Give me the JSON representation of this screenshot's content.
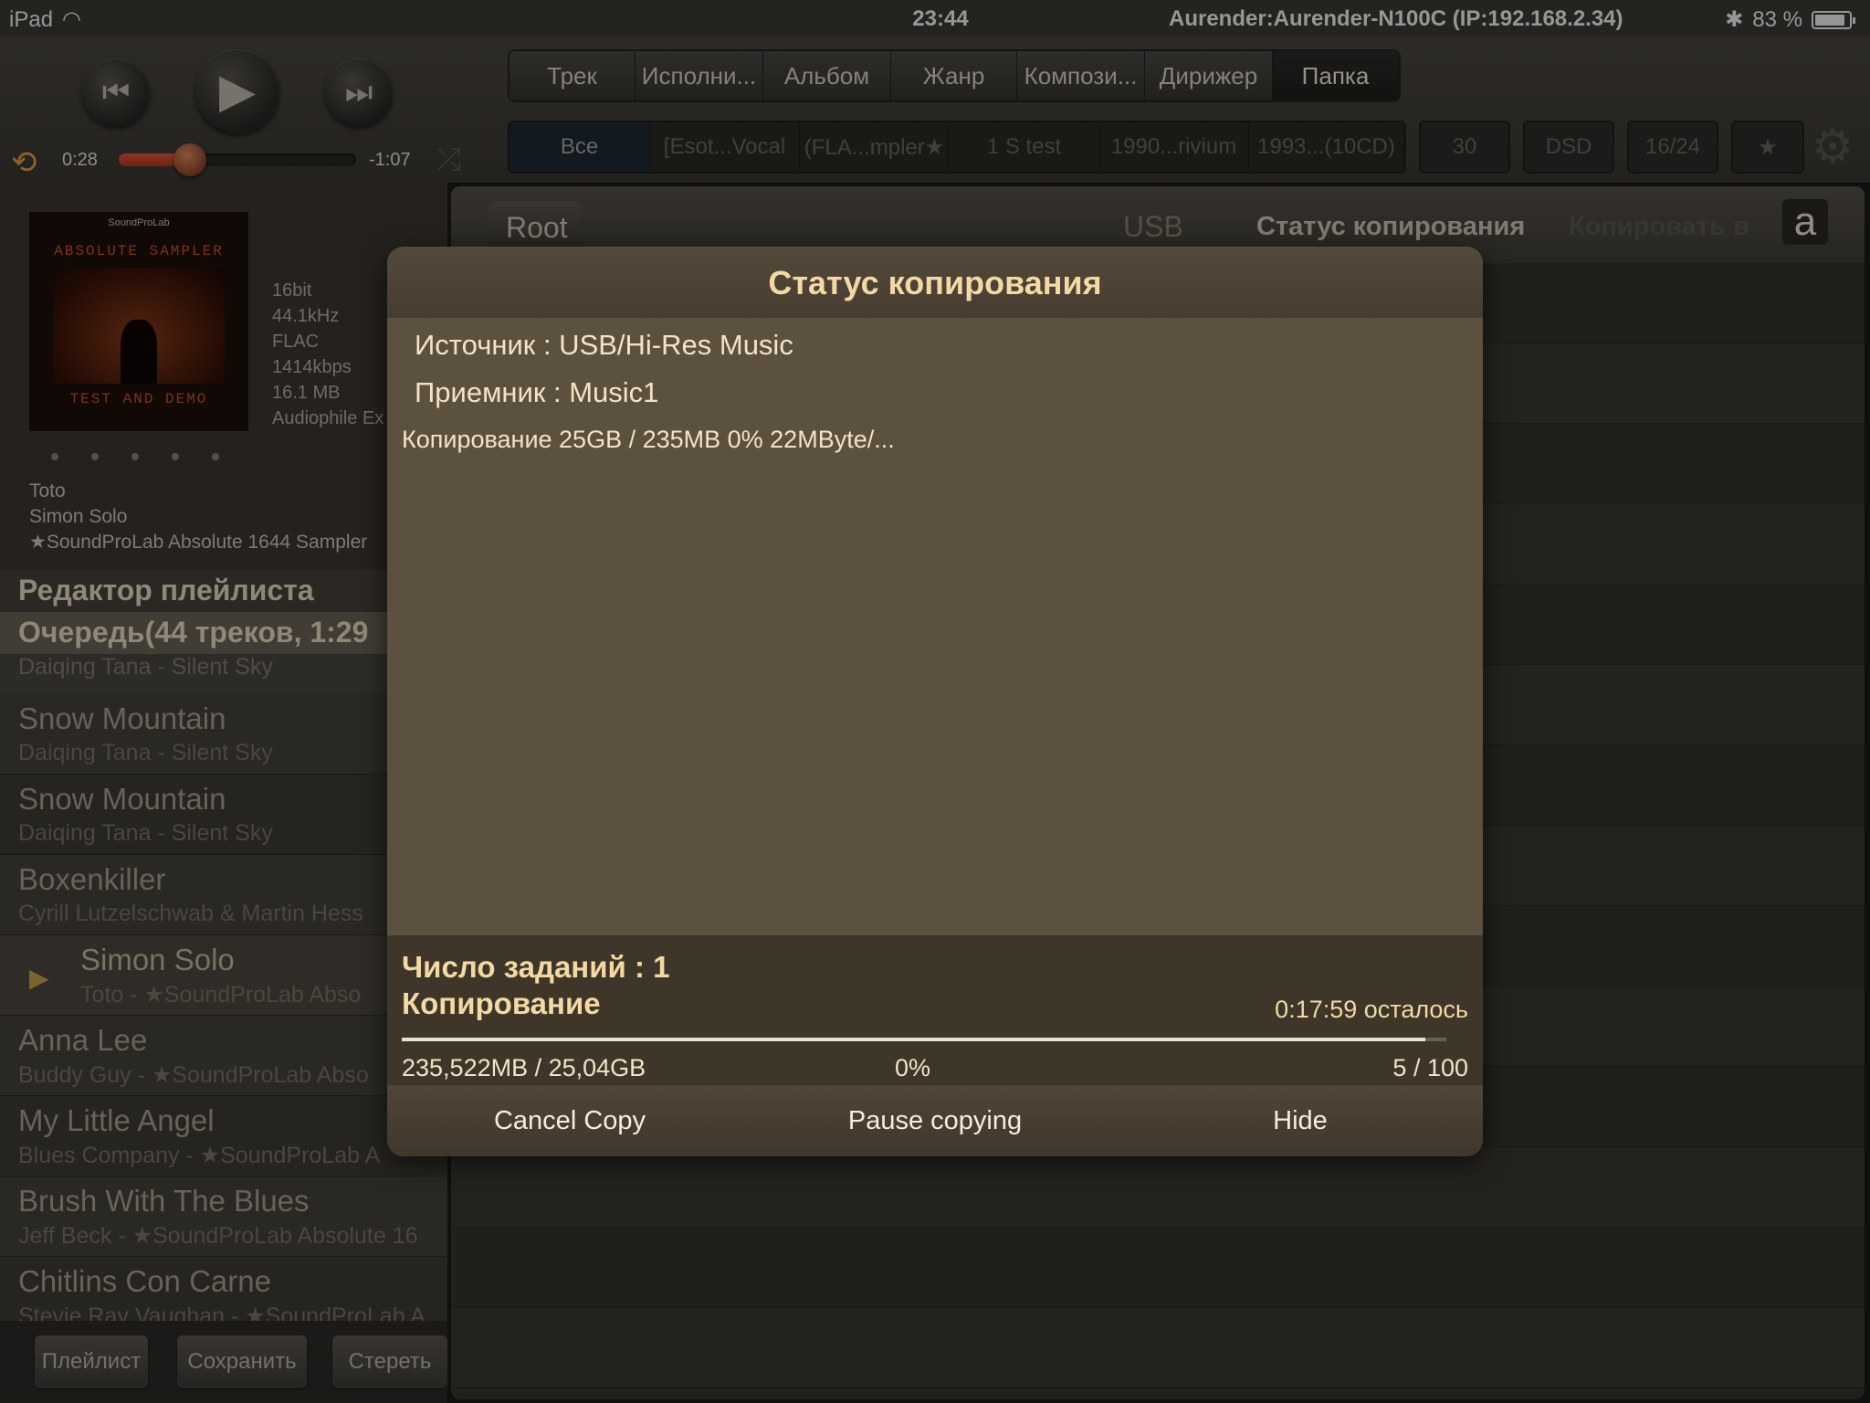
{
  "status_bar": {
    "device": "iPad",
    "time": "23:44",
    "connection": "Aurender:Aurender-N100C (IP:192.168.2.34)",
    "battery": "83 %"
  },
  "player": {
    "elapsed": "0:28",
    "remaining": "-1:07",
    "progress": 0.3
  },
  "tabs": [
    "Трек",
    "Исполни...",
    "Альбом",
    "Жанр",
    "Компози...",
    "Дирижер",
    "Папка"
  ],
  "active_tab": "Папка",
  "filters": [
    "Все",
    "[Esot...Vocal",
    "(FLA...mpler★",
    "1 S test",
    "1990...rivium",
    "1993...(10CD)"
  ],
  "chips": [
    "30",
    "DSD",
    "16/24",
    "★"
  ],
  "now_playing": {
    "album_art": {
      "logo": "SoundProLab",
      "title": "ABSOLUTE SAMPLER",
      "bottom": "TEST AND DEMO"
    },
    "meta": [
      "16bit",
      "44.1kHz",
      "FLAC",
      "1414kbps",
      "16.1 MB",
      "Audiophile Ex"
    ],
    "artist": "Toto",
    "title": "Simon Solo",
    "album": "★SoundProLab Absolute 1644 Sampler"
  },
  "playlist_editor": "Редактор плейлиста",
  "queue_header": "Очередь(44 треков, 1:29",
  "queue_first_subtitle": "Daiqing Tana - Silent Sky",
  "queue": [
    {
      "title": "Snow Mountain",
      "subtitle": "Daiqing Tana - Silent Sky"
    },
    {
      "title": "Snow Mountain",
      "subtitle": "Daiqing Tana - Silent Sky"
    },
    {
      "title": "Boxenkiller",
      "subtitle": "Cyrill Lutzelschwab & Martin Hess"
    },
    {
      "title": "Simon Solo",
      "subtitle": "Toto - ★SoundProLab Abso"
    },
    {
      "title": "Anna Lee",
      "subtitle": "Buddy Guy - ★SoundProLab Abso"
    },
    {
      "title": "My Little Angel",
      "subtitle": "Blues Company - ★SoundProLab A"
    },
    {
      "title": "Brush With The Blues",
      "subtitle": "Jeff Beck - ★SoundProLab Absolute 16"
    },
    {
      "title": "Chitlins Con Carne",
      "subtitle": "Stevie Ray Vaughan - ★SoundProLab A"
    }
  ],
  "bottom_buttons": [
    "Плейлист",
    "Сохранить",
    "Стереть"
  ],
  "browser_nav": {
    "root": "Root",
    "usb": "USB",
    "status": "Статус копирования",
    "copy_to": "Копировать в",
    "a_icon": "a"
  },
  "dialog": {
    "title": "Статус копирования",
    "source": "Источник : USB/Hi-Res Music",
    "destination": "Приемник : Music1",
    "progress_line": "Копирование 25GB / 235MB 0% 22MByte/...",
    "jobs": "Число заданий : 1",
    "state": "Копирование",
    "remaining": "0:17:59 осталось",
    "progress": 0.98,
    "size": "235,522MB / 25,04GB",
    "percent": "0%",
    "files": "5 / 100",
    "actions": [
      "Cancel Copy",
      "Pause copying",
      "Hide"
    ]
  }
}
